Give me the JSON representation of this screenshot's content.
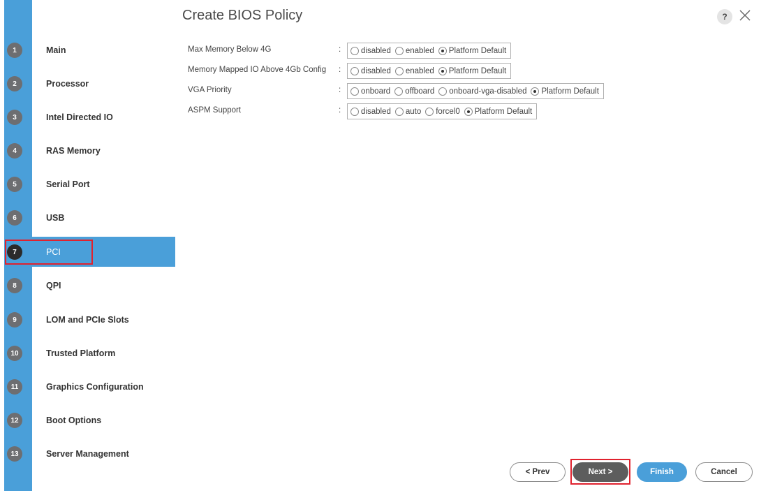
{
  "dialog": {
    "title": "Create BIOS Policy",
    "help_icon": "?"
  },
  "steps": [
    {
      "num": "1",
      "label": "Main"
    },
    {
      "num": "2",
      "label": "Processor"
    },
    {
      "num": "3",
      "label": "Intel Directed IO"
    },
    {
      "num": "4",
      "label": "RAS Memory"
    },
    {
      "num": "5",
      "label": "Serial Port"
    },
    {
      "num": "6",
      "label": "USB"
    },
    {
      "num": "7",
      "label": "PCI"
    },
    {
      "num": "8",
      "label": "QPI"
    },
    {
      "num": "9",
      "label": "LOM and PCIe Slots"
    },
    {
      "num": "10",
      "label": "Trusted Platform"
    },
    {
      "num": "11",
      "label": "Graphics Configuration"
    },
    {
      "num": "12",
      "label": "Boot Options"
    },
    {
      "num": "13",
      "label": "Server Management"
    }
  ],
  "active_step": "PCI",
  "settings": [
    {
      "label": "Max Memory Below 4G",
      "colon": ":",
      "options": [
        "disabled",
        "enabled",
        "Platform Default"
      ],
      "selected": "Platform Default"
    },
    {
      "label": "Memory Mapped IO Above 4Gb Config",
      "colon": ":",
      "options": [
        "disabled",
        "enabled",
        "Platform Default"
      ],
      "selected": "Platform Default"
    },
    {
      "label": "VGA Priority",
      "colon": ":",
      "options": [
        "onboard",
        "offboard",
        "onboard-vga-disabled",
        "Platform Default"
      ],
      "selected": "Platform Default"
    },
    {
      "label": "ASPM Support",
      "colon": ":",
      "options": [
        "disabled",
        "auto",
        "forcel0",
        "Platform Default"
      ],
      "selected": "Platform Default"
    }
  ],
  "buttons": {
    "prev": "< Prev",
    "next": "Next >",
    "finish": "Finish",
    "cancel": "Cancel"
  },
  "colors": {
    "accent": "#4a9fd9",
    "step_badge": "#6d6e71",
    "active_badge": "#2b2b2b",
    "highlight": "#e0222e",
    "next_button": "#5d5d5d"
  },
  "icons": {
    "help": "help-icon",
    "close": "close-icon"
  }
}
